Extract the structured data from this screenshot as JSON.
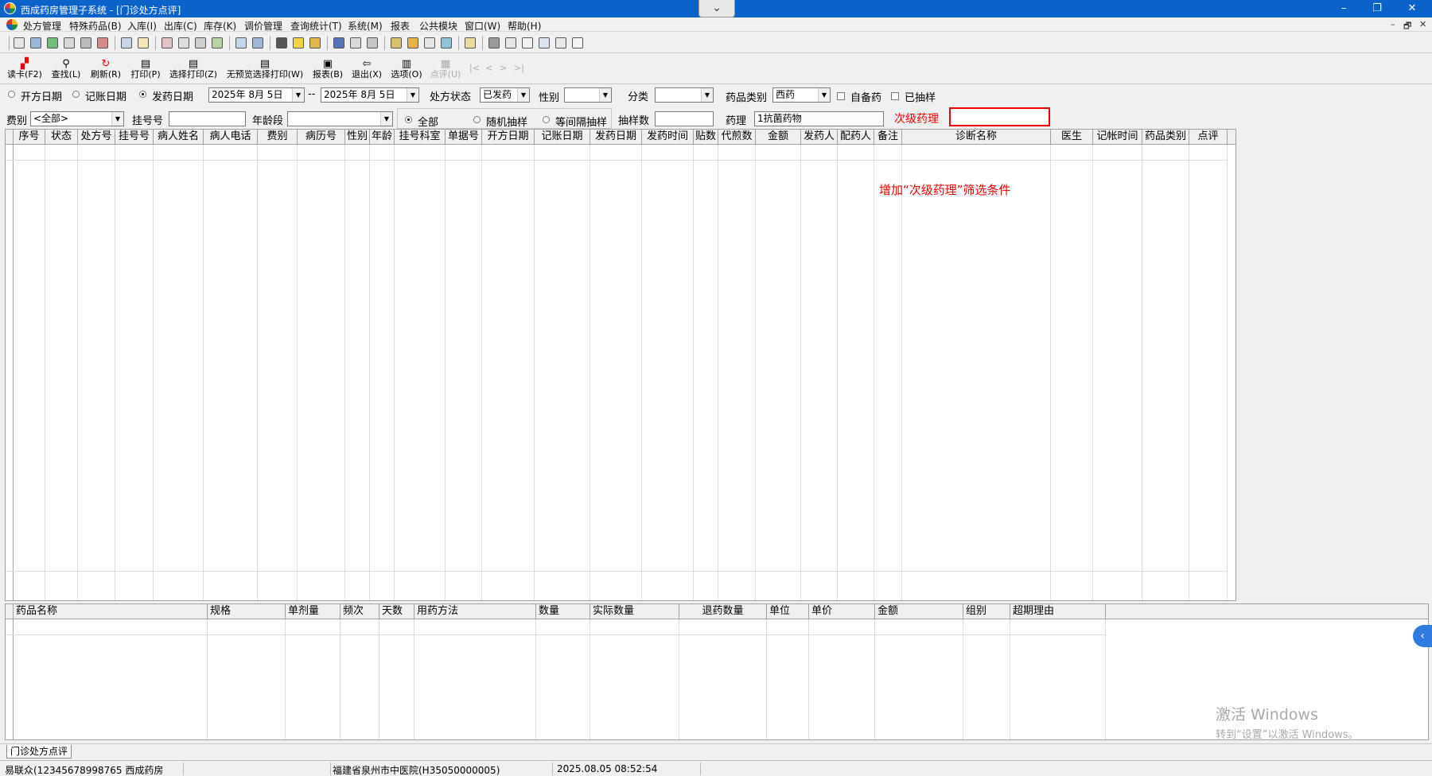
{
  "window": {
    "title": "西成药房管理子系统 - [门诊处方点评]",
    "controls": {
      "minimize": "–",
      "restore": "❐",
      "close": "✕"
    },
    "drop_tab": "⌄"
  },
  "menubar": {
    "items": [
      "处方管理",
      "特殊药品(B)",
      "入库(I)",
      "出库(C)",
      "库存(K)",
      "调价管理",
      "查询统计(T)",
      "系统(M)",
      "报表",
      "公共模块",
      "窗口(W)",
      "帮助(H)"
    ],
    "mdi_controls": [
      "–",
      "🗗",
      "✕"
    ]
  },
  "toolbar_buttons": [
    {
      "label": "读卡(F2)",
      "icon": "card-reader-icon",
      "glyph": "▞"
    },
    {
      "label": "查找(L)",
      "icon": "magnifier-icon",
      "glyph": "⚲"
    },
    {
      "label": "刷新(R)",
      "icon": "refresh-icon",
      "glyph": "↻"
    },
    {
      "label": "打印(P)",
      "icon": "printer-icon",
      "glyph": "▤"
    },
    {
      "label": "选择打印(Z)",
      "icon": "printer-icon",
      "glyph": "▤"
    },
    {
      "label": "无预览选择打印(W)",
      "icon": "printer-icon",
      "glyph": "▤"
    },
    {
      "label": "报表(B)",
      "icon": "save-disk-icon",
      "glyph": "▣"
    },
    {
      "label": "退出(X)",
      "icon": "exit-door-icon",
      "glyph": "⇦"
    },
    {
      "label": "选项(O)",
      "icon": "options-icon",
      "glyph": "▥"
    },
    {
      "label": "点评(U)",
      "icon": "review-icon",
      "glyph": "▦",
      "disabled": true
    }
  ],
  "nav_arrows": [
    "|<",
    "<",
    ">",
    ">|"
  ],
  "filters": {
    "date_type_options": [
      "开方日期",
      "记账日期",
      "发药日期"
    ],
    "date_type_selected": "发药日期",
    "date_from": "2025年 8月 5日",
    "date_sep": "--",
    "date_to": "2025年 8月 5日",
    "rx_status_label": "处方状态",
    "rx_status_value": "已发药",
    "gender_label": "性别",
    "gender_value": "",
    "category_label": "分类",
    "category_value": "",
    "drug_type_label": "药品类别",
    "drug_type_value": "西药",
    "self_prepared_label": "自备药",
    "sampled_label": "已抽样",
    "fee_label": "费别",
    "fee_value": "<全部>",
    "reg_no_label": "挂号号",
    "reg_no_value": "",
    "age_label": "年龄段",
    "age_value": "",
    "sample_options": [
      "全部",
      "随机抽样",
      "等间隔抽样"
    ],
    "sample_selected": "全部",
    "sample_count_label": "抽样数",
    "sample_count_value": "",
    "pharm_label": "药理",
    "pharm_value": "1抗菌药物",
    "sub_pharm_label": "次级药理",
    "sub_pharm_value": ""
  },
  "annotation": "增加“次级药理”筛选条件",
  "main_table": {
    "columns": [
      "序号",
      "状态",
      "处方号",
      "挂号号",
      "病人姓名",
      "病人电话",
      "费别",
      "病历号",
      "性别",
      "年龄",
      "挂号科室",
      "单据号",
      "开方日期",
      "记账日期",
      "发药日期",
      "发药时间",
      "贴数",
      "代煎数",
      "金额",
      "发药人",
      "配药人",
      "备注",
      "诊断名称",
      "医生",
      "记帐时间",
      "药品类别",
      "点评"
    ],
    "rows": []
  },
  "detail_table": {
    "columns": [
      "药品名称",
      "规格",
      "单剂量",
      "频次",
      "天数",
      "用药方法",
      "数量",
      "实际数量",
      "退药数量",
      "单位",
      "单价",
      "金额",
      "组别",
      "超期理由"
    ],
    "rows": []
  },
  "tabs": [
    "门诊处方点评"
  ],
  "statusbar": {
    "user": "易联众(12345678998765 西成药房",
    "hospital": "福建省泉州市中医院(H35050000005)",
    "datetime": "2025.08.05 08:52:54"
  },
  "watermark": {
    "line1": "激活 Windows",
    "line2": "转到“设置”以激活 Windows。"
  },
  "side_handle": "‹"
}
